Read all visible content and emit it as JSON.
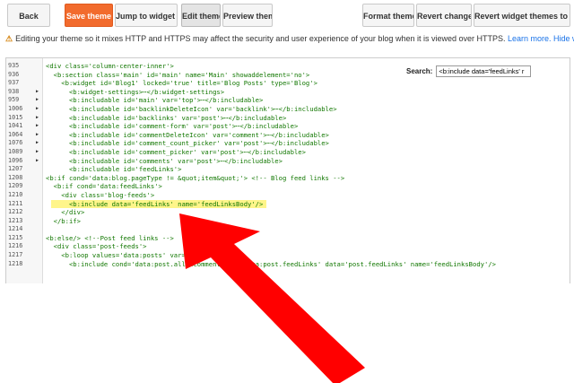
{
  "toolbar": {
    "back": "Back",
    "save": "Save theme",
    "jump": "Jump to widget",
    "edit": "Edit theme",
    "preview": "Preview theme",
    "format": "Format theme",
    "revert_changes": "Revert changes",
    "revert_widget": "Revert widget themes to defa"
  },
  "warning": {
    "icon": "warning-icon",
    "text": "Editing your theme so it mixes HTTP and HTTPS may affect the security and user experience of your blog when it is viewed over HTTPS.",
    "learn_more": "Learn more.",
    "hide": "Hide warning"
  },
  "search": {
    "label": "Search:",
    "value": "<b:include data='feedLinks' r"
  },
  "colors": {
    "save_button": "#f26b2d",
    "highlight": "#fff58a",
    "arrow": "#ff0000",
    "code_text": "#117700",
    "link": "#1a73e8"
  },
  "code_lines": [
    {
      "num": "935",
      "fold": "",
      "text": "<div class='column-center-inner'>"
    },
    {
      "num": "936",
      "fold": "",
      "text": "  <b:section class='main' id='main' name='Main' showaddelement='no'>"
    },
    {
      "num": "937",
      "fold": "",
      "text": "    <b:widget id='Blog1' locked='true' title='Blog Posts' type='Blog'>"
    },
    {
      "num": "938",
      "fold": "▶",
      "text": "      <b:widget-settings>⋯</b:widget-settings>"
    },
    {
      "num": "959",
      "fold": "▶",
      "text": "      <b:includable id='main' var='top'>⋯</b:includable>"
    },
    {
      "num": "1006",
      "fold": "▶",
      "text": "      <b:includable id='backlinkDeleteIcon' var='backlink'>⋯</b:includable>"
    },
    {
      "num": "1015",
      "fold": "▶",
      "text": "      <b:includable id='backlinks' var='post'>⋯</b:includable>"
    },
    {
      "num": "1041",
      "fold": "▶",
      "text": "      <b:includable id='comment-form' var='post'>⋯</b:includable>"
    },
    {
      "num": "1064",
      "fold": "▶",
      "text": "      <b:includable id='commentDeleteIcon' var='comment'>⋯</b:includable>"
    },
    {
      "num": "1076",
      "fold": "▶",
      "text": "      <b:includable id='comment_count_picker' var='post'>⋯</b:includable>"
    },
    {
      "num": "1089",
      "fold": "▶",
      "text": "      <b:includable id='comment_picker' var='post'>⋯</b:includable>"
    },
    {
      "num": "1096",
      "fold": "▶",
      "text": "      <b:includable id='comments' var='post'>⋯</b:includable>"
    },
    {
      "num": "1207",
      "fold": "",
      "text": "      <b:includable id='feedLinks'>"
    },
    {
      "num": "1208",
      "fold": "",
      "text": "<b:if cond='data:blog.pageType != &quot;item&quot;'> <!-- Blog feed links -->"
    },
    {
      "num": "1209",
      "fold": "",
      "text": "  <b:if cond='data:feedLinks'>"
    },
    {
      "num": "1210",
      "fold": "",
      "text": "    <div class='blog-feeds'>"
    },
    {
      "num": "1211",
      "fold": "",
      "text": "      <b:include data='feedLinks' name='feedLinksBody'/>",
      "hl": true
    },
    {
      "num": "1212",
      "fold": "",
      "text": "    </div>"
    },
    {
      "num": "1213",
      "fold": "",
      "text": "  </b:if>"
    },
    {
      "num": "1214",
      "fold": "",
      "text": ""
    },
    {
      "num": "1215",
      "fold": "",
      "text": "<b:else/> <!--Post feed links -->"
    },
    {
      "num": "1216",
      "fold": "",
      "text": "  <div class='post-feeds'>"
    },
    {
      "num": "1217",
      "fold": "",
      "text": "    <b:loop values='data:posts' var='post'>"
    },
    {
      "num": "1218",
      "fold": "",
      "text": "      <b:include cond='data:post.allowComments and data:post.feedLinks' data='post.feedLinks' name='feedLinksBody'/>"
    }
  ]
}
